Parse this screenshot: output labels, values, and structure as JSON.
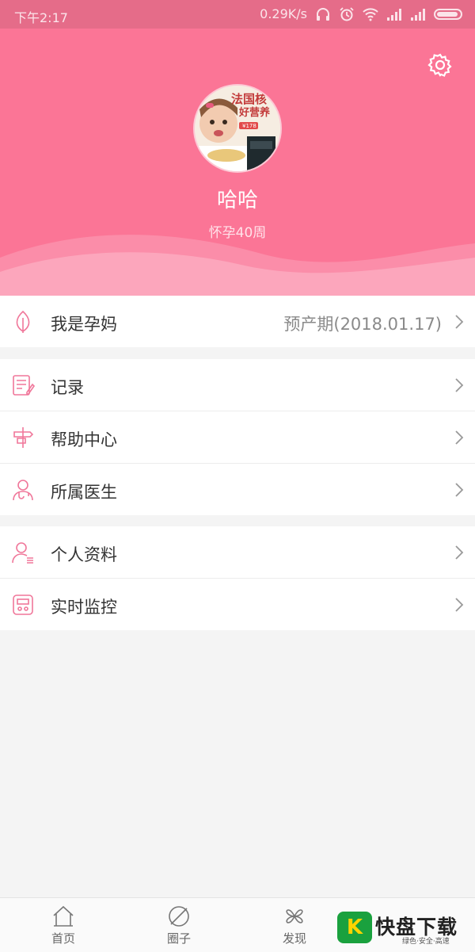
{
  "status_bar": {
    "time": "下午2:17",
    "network_speed": "0.29K/s",
    "icons": [
      "headphones-icon",
      "alarm-icon",
      "wifi-icon",
      "signal-icon",
      "signal-icon",
      "battery-icon"
    ]
  },
  "profile": {
    "username": "哈哈",
    "pregnancy_status": "怀孕40周",
    "avatar_text_top": "法国核",
    "avatar_text_bottom": "好营养",
    "avatar_price": "¥178"
  },
  "menu_groups": [
    {
      "items": [
        {
          "icon": "leaf-icon",
          "label": "我是孕妈",
          "value": "预产期(2018.01.17)"
        }
      ]
    },
    {
      "items": [
        {
          "icon": "notepad-icon",
          "label": "记录"
        },
        {
          "icon": "signpost-icon",
          "label": "帮助中心"
        },
        {
          "icon": "doctor-icon",
          "label": "所属医生"
        }
      ]
    },
    {
      "items": [
        {
          "icon": "person-profile-icon",
          "label": "个人资料"
        },
        {
          "icon": "monitor-icon",
          "label": "实时监控"
        }
      ]
    }
  ],
  "tabs": [
    {
      "icon": "home-icon",
      "label": "首页"
    },
    {
      "icon": "circle-icon",
      "label": "圈子"
    },
    {
      "icon": "discover-icon",
      "label": "发现"
    }
  ],
  "watermark": {
    "logo_letter": "K",
    "text": "快盘下载",
    "subtext": "绿色·安全·高速"
  },
  "colors": {
    "header_pink": "#fb7596",
    "accent_pink": "#f0779a",
    "status_bar": "#e56c89"
  }
}
